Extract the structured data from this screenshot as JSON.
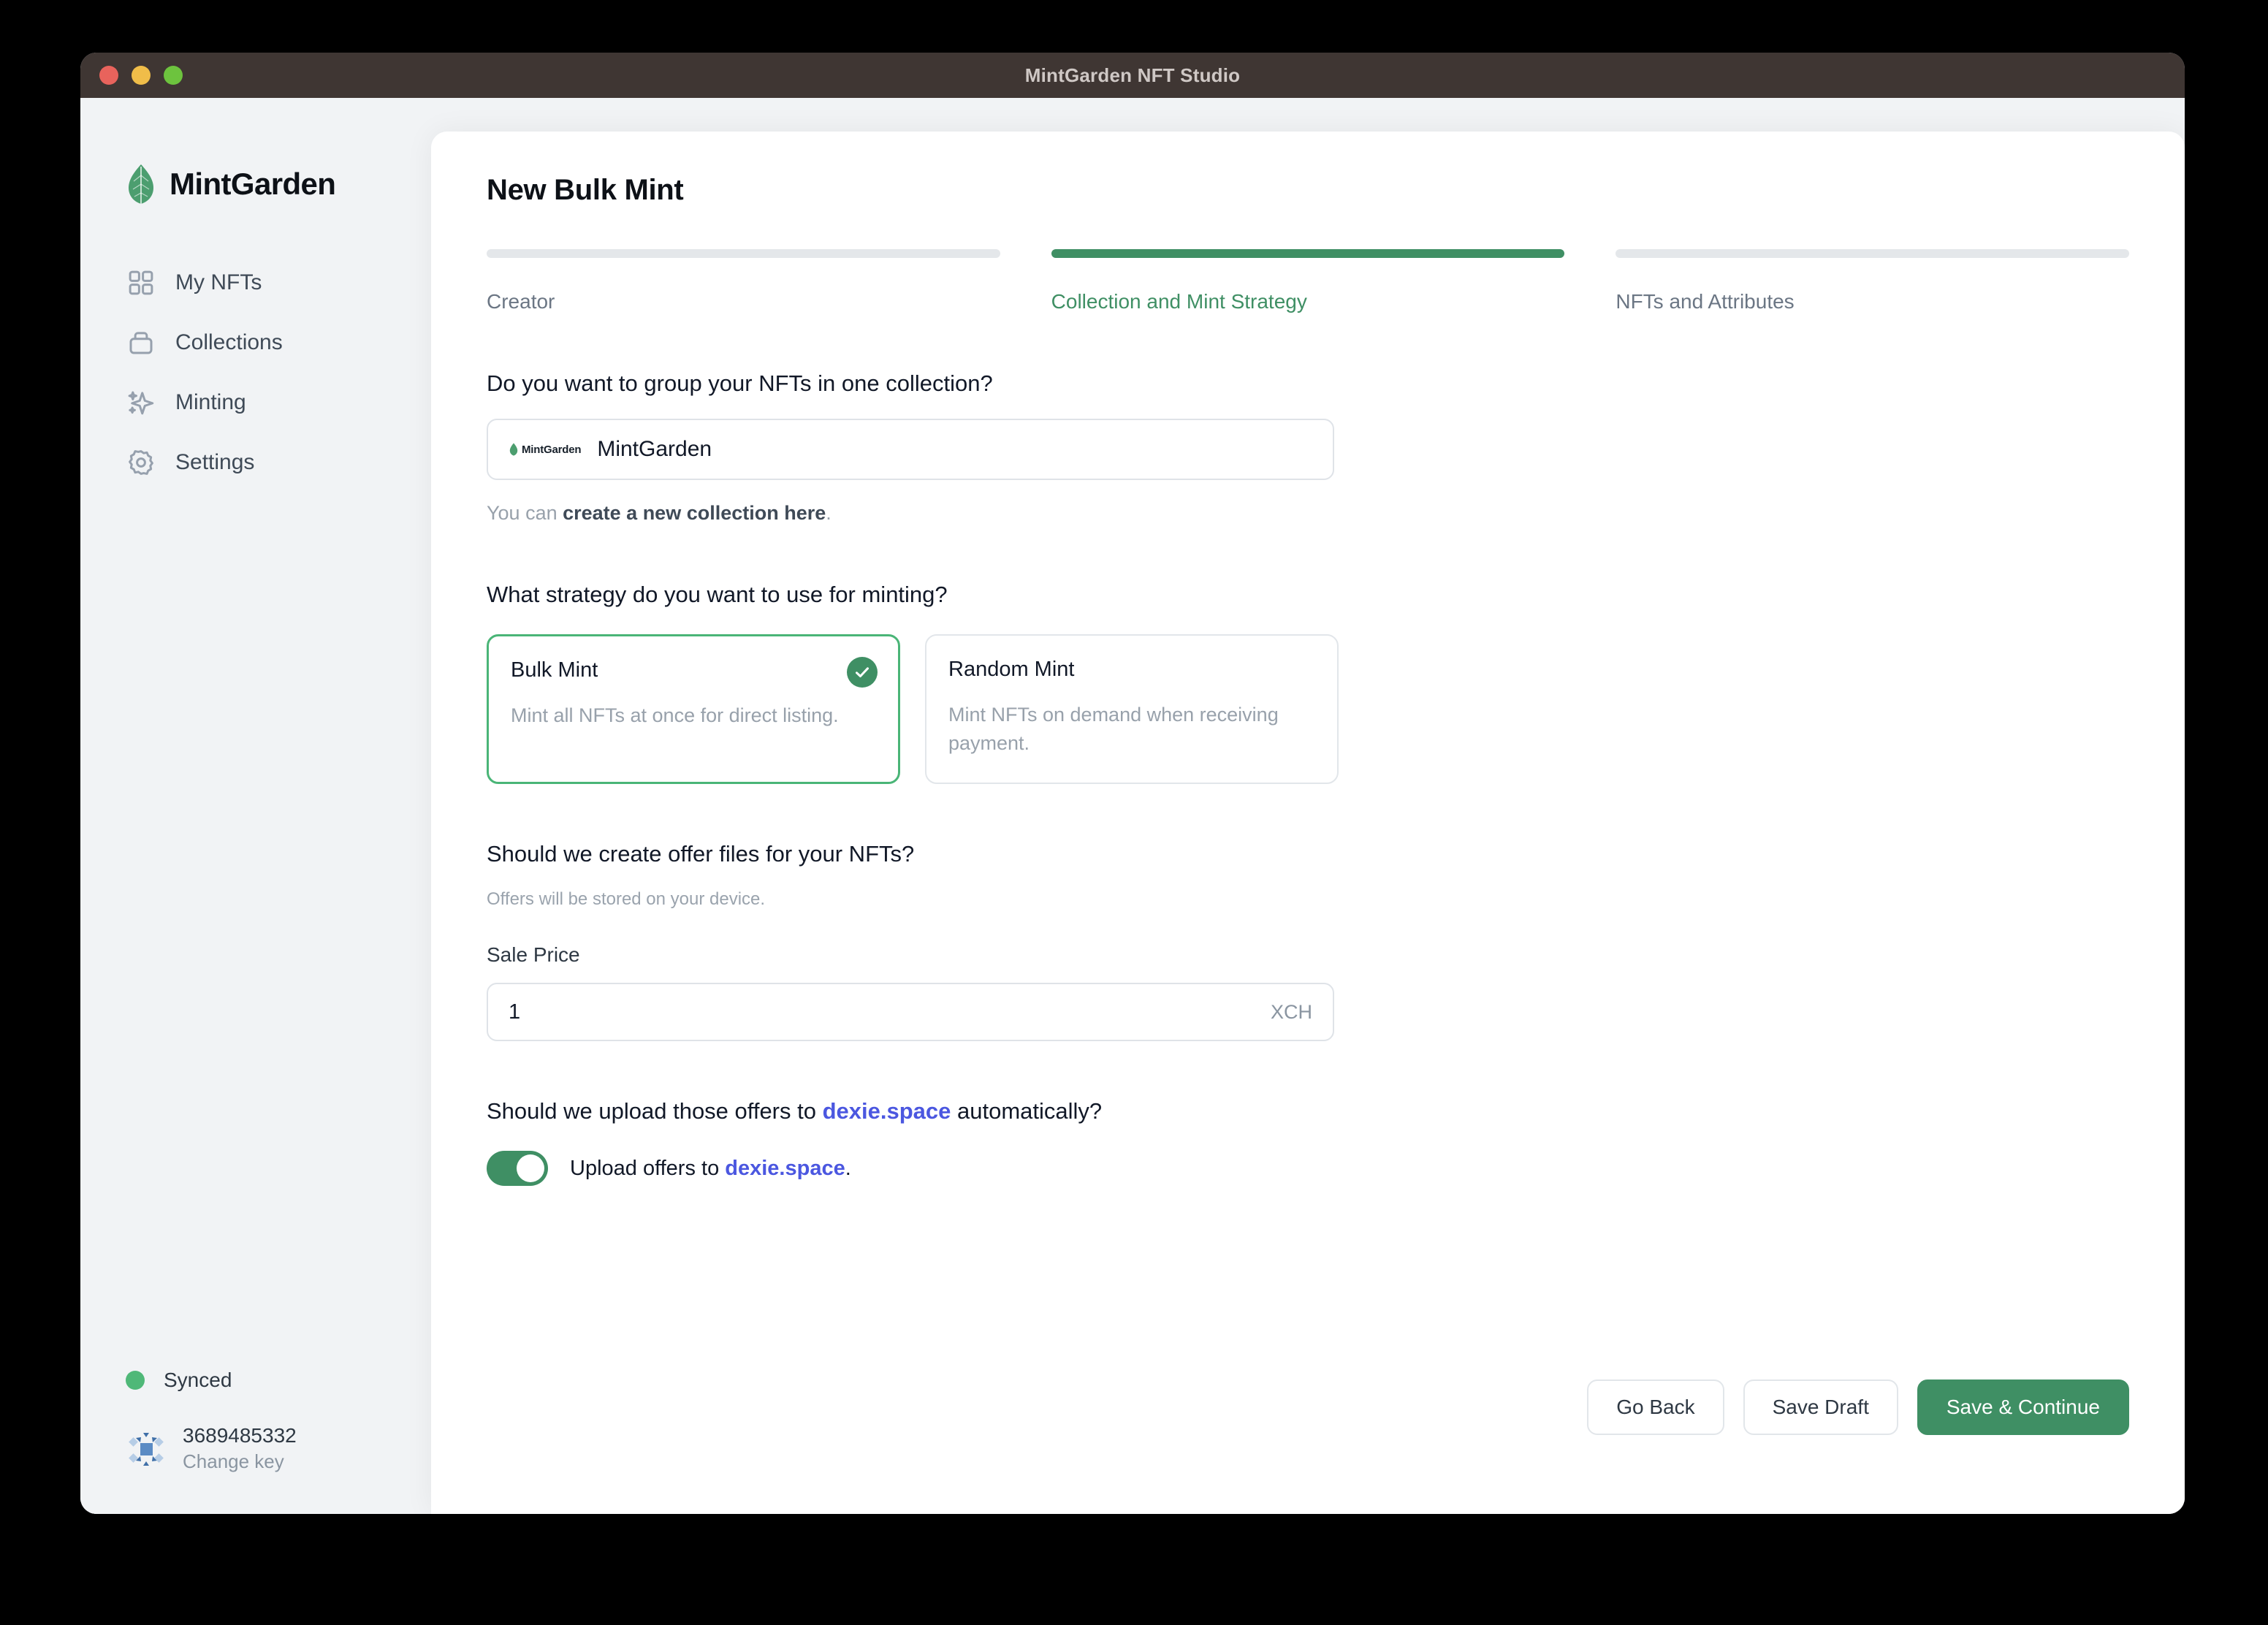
{
  "window": {
    "title": "MintGarden NFT Studio",
    "traffic_lights": [
      "close-red",
      "minimize-yellow",
      "maximize-green"
    ]
  },
  "sidebar": {
    "brand": "MintGarden",
    "brand_icon": "leaf-icon",
    "items": [
      {
        "label": "My NFTs",
        "icon": "grid-icon"
      },
      {
        "label": "Collections",
        "icon": "archive-box-icon"
      },
      {
        "label": "Minting",
        "icon": "sparkles-icon"
      },
      {
        "label": "Settings",
        "icon": "gear-icon"
      }
    ],
    "footer": {
      "sync_status": "Synced",
      "sync_color": "#4fb878",
      "key_id": "3689485332",
      "change_key": "Change key",
      "key_icon": "identicon"
    }
  },
  "main": {
    "page_title": "New Bulk Mint",
    "steps": [
      {
        "label": "Creator",
        "active": false
      },
      {
        "label": "Collection and Mint Strategy",
        "active": true
      },
      {
        "label": "NFTs and Attributes",
        "active": false
      }
    ],
    "collection": {
      "question": "Do you want to group your NFTs in one collection?",
      "selected": "MintGarden",
      "badge_logo": "MintGarden",
      "helper_prefix": "You can ",
      "helper_link": "create a new collection here",
      "helper_suffix": "."
    },
    "strategy": {
      "question": "What strategy do you want to use for minting?",
      "options": [
        {
          "title": "Bulk Mint",
          "description": "Mint all NFTs at once for direct listing.",
          "selected": true
        },
        {
          "title": "Random Mint",
          "description": "Mint NFTs on demand when receiving payment.",
          "selected": false
        }
      ]
    },
    "offers": {
      "question": "Should we create offer files for your NFTs?",
      "subtext": "Offers will be stored on your device.",
      "price_label": "Sale Price",
      "price_value": "1",
      "price_unit": "XCH"
    },
    "upload": {
      "question_prefix": "Should we upload those offers to ",
      "question_link": "dexie.space",
      "question_suffix": " automatically?",
      "toggle_on": true,
      "toggle_label_prefix": "Upload offers to ",
      "toggle_label_link": "dexie.space",
      "toggle_label_suffix": "."
    },
    "actions": {
      "go_back": "Go Back",
      "save_draft": "Save Draft",
      "save_continue": "Save & Continue"
    }
  },
  "colors": {
    "accent_green": "#3f8f64",
    "link_blue": "#4b57e0",
    "titlebar": "#3f3633",
    "app_bg": "#f1f3f5"
  }
}
